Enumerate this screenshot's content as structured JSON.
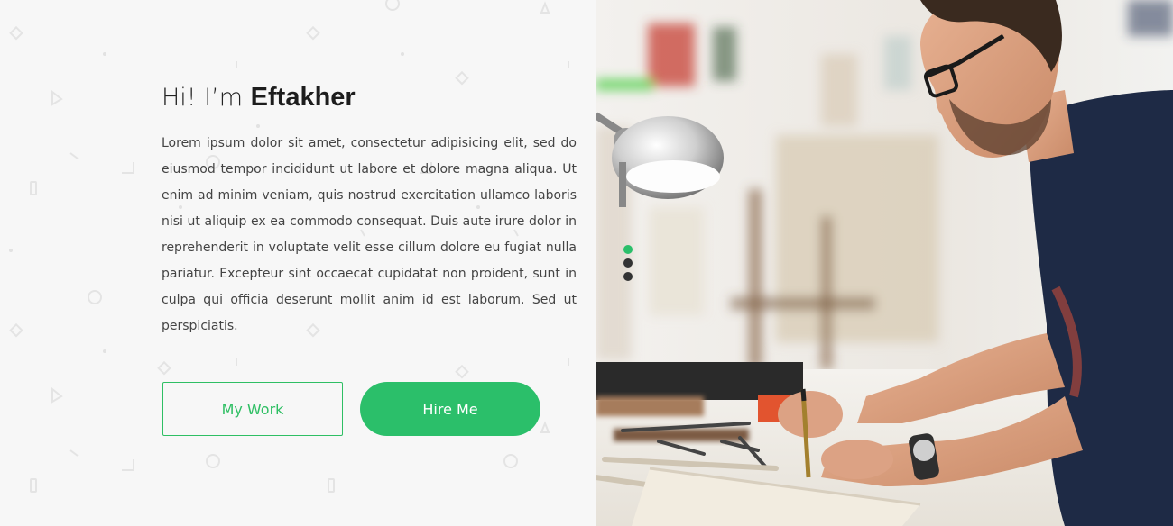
{
  "hero": {
    "greeting": "Hi! I’m",
    "name": "Eftakher",
    "bio": "Lorem ipsum dolor sit amet, consectetur adipisicing elit, sed do eiusmod tempor incididunt ut labore et dolore magna aliqua. Ut enim ad minim veniam, quis nostrud exercitation ullamco laboris nisi ut aliquip ex ea commodo consequat. Duis aute irure dolor in reprehenderit in voluptate velit esse cillum dolore eu fugiat nulla pariatur. Excepteur sint occaecat cupidatat non proident, sunt in culpa qui officia deserunt mollit anim id est laborum. Sed ut perspiciatis.",
    "buttons": {
      "my_work": "My Work",
      "hire_me": "Hire Me"
    }
  },
  "slider": {
    "dots": 3,
    "active_index": 0
  },
  "colors": {
    "accent": "#2bbf6a",
    "background": "#f7f7f7",
    "text": "#444444"
  }
}
